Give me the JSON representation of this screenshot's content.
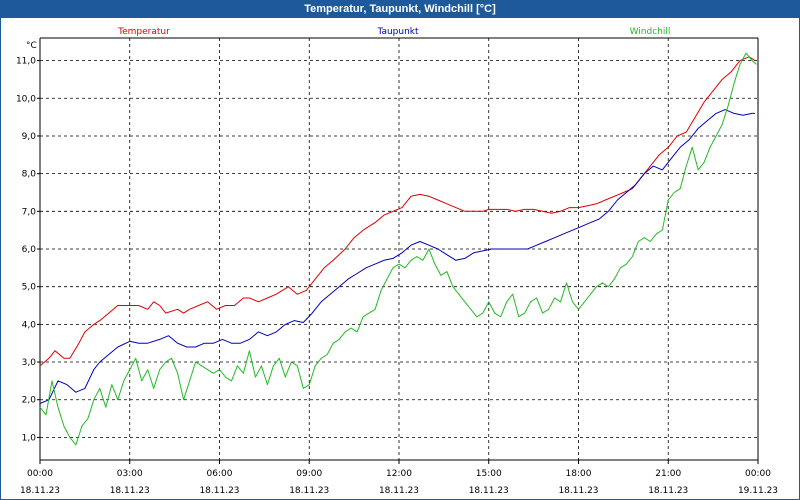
{
  "window": {
    "title": "Temperatur, Taupunkt, Windchill [°C]"
  },
  "colors": {
    "titlebar": "#1e5a9a",
    "temperatur": "#dd0000",
    "taupunkt": "#0000bb",
    "windchill": "#22bb22"
  },
  "chart_data": {
    "type": "line",
    "title": "Temperatur, Taupunkt, Windchill [°C]",
    "ylabel": "°C",
    "ylim": [
      0.4,
      11.6
    ],
    "xlim_hours": [
      0,
      24
    ],
    "grid": true,
    "legend_placement": "top",
    "y_ticks": [
      "1,0",
      "2,0",
      "3,0",
      "4,0",
      "5,0",
      "6,0",
      "7,0",
      "8,0",
      "9,0",
      "10,0",
      "11,0"
    ],
    "x_ticks": [
      {
        "time": "00:00",
        "date": "18.11.23"
      },
      {
        "time": "03:00",
        "date": "18.11.23"
      },
      {
        "time": "06:00",
        "date": "18.11.23"
      },
      {
        "time": "09:00",
        "date": "18.11.23"
      },
      {
        "time": "12:00",
        "date": "18.11.23"
      },
      {
        "time": "15:00",
        "date": "18.11.23"
      },
      {
        "time": "18:00",
        "date": "18.11.23"
      },
      {
        "time": "21:00",
        "date": "18.11.23"
      },
      {
        "time": "00:00",
        "date": "19.11.23"
      }
    ],
    "series": [
      {
        "name": "Temperatur",
        "color": "#dd0000",
        "x": [
          0,
          0.3,
          0.5,
          0.8,
          1.0,
          1.3,
          1.5,
          1.8,
          2.0,
          2.3,
          2.6,
          3.0,
          3.3,
          3.6,
          3.8,
          4.0,
          4.2,
          4.6,
          4.8,
          5.0,
          5.3,
          5.6,
          5.9,
          6.2,
          6.5,
          6.8,
          7.0,
          7.3,
          7.6,
          7.9,
          8.3,
          8.6,
          8.9,
          9.2,
          9.5,
          9.8,
          10.2,
          10.5,
          10.8,
          11.2,
          11.5,
          11.8,
          12.1,
          12.4,
          12.7,
          13.0,
          13.3,
          13.6,
          13.9,
          14.2,
          14.5,
          14.8,
          15.0,
          15.3,
          15.6,
          15.9,
          16.2,
          16.5,
          16.8,
          17.1,
          17.4,
          17.7,
          18.0,
          18.3,
          18.6,
          18.9,
          19.2,
          19.5,
          19.8,
          20.1,
          20.4,
          20.7,
          21.0,
          21.3,
          21.6,
          21.9,
          22.2,
          22.5,
          22.8,
          23.1,
          23.4,
          23.7,
          23.9
        ],
        "values": [
          2.9,
          3.1,
          3.3,
          3.1,
          3.1,
          3.5,
          3.8,
          4.0,
          4.1,
          4.3,
          4.5,
          4.5,
          4.5,
          4.4,
          4.6,
          4.5,
          4.3,
          4.4,
          4.3,
          4.4,
          4.5,
          4.6,
          4.4,
          4.5,
          4.5,
          4.7,
          4.7,
          4.6,
          4.7,
          4.8,
          5.0,
          4.8,
          4.9,
          5.2,
          5.5,
          5.7,
          6.0,
          6.3,
          6.5,
          6.7,
          6.9,
          7.0,
          7.1,
          7.4,
          7.45,
          7.4,
          7.3,
          7.2,
          7.1,
          7.0,
          7.0,
          7.0,
          7.05,
          7.05,
          7.05,
          7.0,
          7.05,
          7.05,
          7.0,
          6.95,
          7.0,
          7.1,
          7.1,
          7.15,
          7.2,
          7.3,
          7.4,
          7.5,
          7.6,
          7.9,
          8.2,
          8.5,
          8.7,
          9.0,
          9.1,
          9.5,
          9.9,
          10.2,
          10.5,
          10.7,
          11.0,
          11.1,
          11.0
        ]
      },
      {
        "name": "Taupunkt",
        "color": "#0000bb",
        "x": [
          0,
          0.3,
          0.6,
          0.9,
          1.2,
          1.5,
          1.8,
          2.0,
          2.3,
          2.6,
          3.0,
          3.3,
          3.6,
          4.0,
          4.3,
          4.6,
          4.9,
          5.2,
          5.5,
          5.8,
          6.1,
          6.4,
          6.7,
          7.0,
          7.3,
          7.6,
          7.9,
          8.2,
          8.5,
          8.8,
          9.1,
          9.4,
          9.7,
          10.0,
          10.3,
          10.6,
          10.9,
          11.2,
          11.5,
          11.8,
          12.1,
          12.4,
          12.7,
          13.0,
          13.3,
          13.6,
          13.9,
          14.2,
          14.5,
          14.8,
          15.1,
          15.4,
          15.7,
          16.0,
          16.3,
          16.6,
          16.9,
          17.2,
          17.5,
          17.8,
          18.1,
          18.4,
          18.7,
          19.0,
          19.3,
          19.6,
          19.9,
          20.2,
          20.5,
          20.8,
          21.1,
          21.4,
          21.7,
          22.0,
          22.3,
          22.6,
          22.9,
          23.2,
          23.5,
          23.8,
          23.9
        ],
        "values": [
          1.9,
          2.0,
          2.5,
          2.4,
          2.2,
          2.3,
          2.8,
          3.0,
          3.2,
          3.4,
          3.55,
          3.5,
          3.5,
          3.6,
          3.7,
          3.5,
          3.4,
          3.4,
          3.5,
          3.5,
          3.6,
          3.5,
          3.5,
          3.6,
          3.8,
          3.7,
          3.8,
          4.0,
          4.1,
          4.05,
          4.3,
          4.6,
          4.8,
          5.0,
          5.2,
          5.35,
          5.5,
          5.6,
          5.7,
          5.75,
          5.9,
          6.1,
          6.2,
          6.1,
          6.0,
          5.85,
          5.7,
          5.75,
          5.9,
          5.95,
          6.0,
          6.0,
          6.0,
          6.0,
          6.0,
          6.1,
          6.2,
          6.3,
          6.4,
          6.5,
          6.6,
          6.7,
          6.8,
          7.0,
          7.3,
          7.5,
          7.7,
          8.0,
          8.2,
          8.1,
          8.4,
          8.7,
          8.9,
          9.2,
          9.4,
          9.6,
          9.7,
          9.6,
          9.55,
          9.6,
          9.6
        ]
      },
      {
        "name": "Windchill",
        "color": "#22bb22",
        "x": [
          0,
          0.2,
          0.4,
          0.6,
          0.8,
          1.0,
          1.2,
          1.4,
          1.6,
          1.8,
          2.0,
          2.2,
          2.4,
          2.6,
          2.8,
          3.0,
          3.2,
          3.4,
          3.6,
          3.8,
          4.0,
          4.2,
          4.4,
          4.6,
          4.8,
          5.0,
          5.2,
          5.4,
          5.6,
          5.8,
          6.0,
          6.2,
          6.4,
          6.6,
          6.8,
          7.0,
          7.2,
          7.4,
          7.6,
          7.8,
          8.0,
          8.2,
          8.4,
          8.6,
          8.8,
          9.0,
          9.2,
          9.4,
          9.6,
          9.8,
          10.0,
          10.2,
          10.4,
          10.6,
          10.8,
          11.0,
          11.2,
          11.4,
          11.6,
          11.8,
          12.0,
          12.2,
          12.4,
          12.6,
          12.8,
          13.0,
          13.2,
          13.4,
          13.6,
          13.8,
          14.0,
          14.2,
          14.4,
          14.6,
          14.8,
          15.0,
          15.2,
          15.4,
          15.6,
          15.8,
          16.0,
          16.2,
          16.4,
          16.6,
          16.8,
          17.0,
          17.2,
          17.4,
          17.6,
          17.8,
          18.0,
          18.2,
          18.4,
          18.6,
          18.8,
          19.0,
          19.2,
          19.4,
          19.6,
          19.8,
          20.0,
          20.2,
          20.4,
          20.6,
          20.8,
          21.0,
          21.2,
          21.4,
          21.6,
          21.8,
          22.0,
          22.2,
          22.4,
          22.6,
          22.8,
          23.0,
          23.2,
          23.4,
          23.6,
          23.8,
          23.95
        ],
        "values": [
          1.8,
          1.6,
          2.5,
          1.8,
          1.3,
          1.0,
          0.8,
          1.3,
          1.5,
          2.0,
          2.3,
          1.8,
          2.4,
          2.0,
          2.5,
          2.8,
          3.1,
          2.5,
          2.8,
          2.3,
          2.8,
          3.0,
          3.1,
          2.7,
          2.0,
          2.5,
          3.0,
          2.9,
          2.8,
          2.7,
          2.8,
          2.6,
          2.5,
          2.9,
          2.7,
          3.3,
          2.6,
          2.9,
          2.4,
          2.9,
          3.1,
          2.6,
          3.0,
          2.9,
          2.3,
          2.4,
          2.9,
          3.1,
          3.2,
          3.5,
          3.6,
          3.8,
          3.9,
          3.8,
          4.2,
          4.3,
          4.4,
          4.9,
          5.2,
          5.5,
          5.6,
          5.5,
          5.7,
          5.8,
          5.7,
          6.0,
          5.6,
          5.3,
          5.4,
          5.0,
          4.8,
          4.6,
          4.4,
          4.2,
          4.3,
          4.6,
          4.3,
          4.2,
          4.6,
          4.8,
          4.2,
          4.3,
          4.6,
          4.7,
          4.3,
          4.4,
          4.7,
          4.6,
          5.1,
          4.6,
          4.4,
          4.6,
          4.8,
          5.0,
          5.1,
          5.0,
          5.2,
          5.5,
          5.6,
          5.8,
          6.2,
          6.3,
          6.2,
          6.4,
          6.5,
          7.3,
          7.5,
          7.6,
          8.2,
          8.7,
          8.1,
          8.3,
          8.7,
          9.0,
          9.3,
          9.8,
          10.4,
          10.9,
          11.2,
          11.0,
          10.9
        ]
      }
    ]
  }
}
